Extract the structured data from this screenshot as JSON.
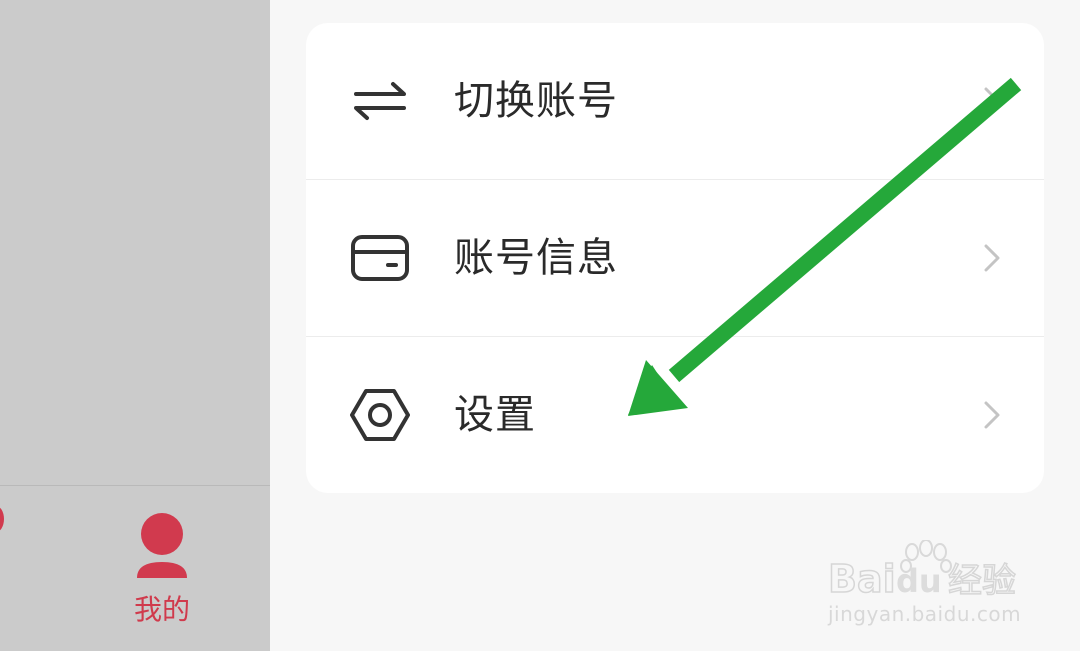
{
  "bottom_nav": {
    "mine_label": "我的"
  },
  "menu": {
    "items": [
      {
        "label": "切换账号",
        "icon": "swap-arrows-icon"
      },
      {
        "label": "账号信息",
        "icon": "card-icon"
      },
      {
        "label": "设置",
        "icon": "hexagon-settings-icon"
      }
    ]
  },
  "watermark": {
    "logo_text": "Baidu 经验",
    "url": "jingyan.baidu.com"
  },
  "colors": {
    "accent_red": "#d03a4c",
    "arrow_green": "#25a83a",
    "dim_overlay": "#cbcbcb",
    "card_bg": "#ffffff",
    "page_bg": "#f7f7f7"
  }
}
